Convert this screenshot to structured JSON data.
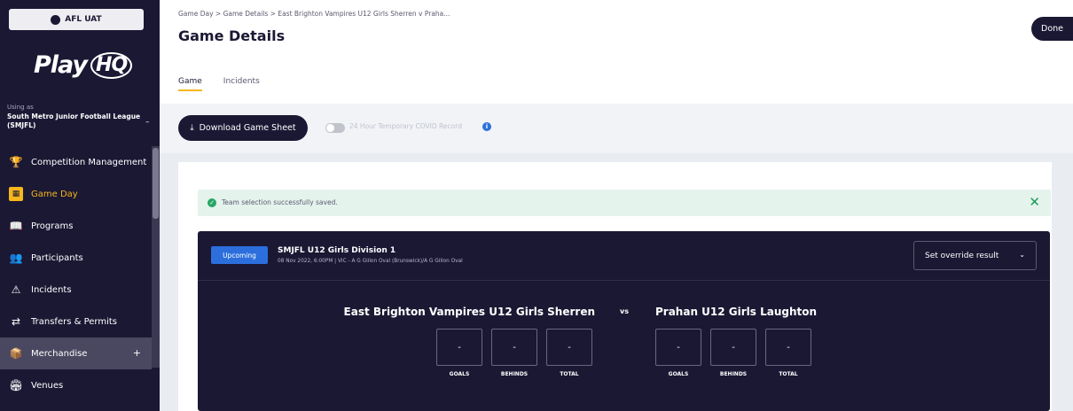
{
  "sidebar": {
    "env_label": "AFL UAT",
    "logo": "PlayHQ",
    "using_as": "Using as",
    "org_name": "South Metro Junior Football League (SMJFL)",
    "items": [
      {
        "label": "Competition Management",
        "icon": "trophy-icon"
      },
      {
        "label": "Game Day",
        "icon": "game-day-icon",
        "active": true
      },
      {
        "label": "Programs",
        "icon": "book-icon"
      },
      {
        "label": "Participants",
        "icon": "people-icon"
      },
      {
        "label": "Incidents",
        "icon": "warning-icon"
      },
      {
        "label": "Transfers & Permits",
        "icon": "transfer-arrows-icon"
      },
      {
        "label": "Merchandise",
        "icon": "box-icon",
        "selected": true,
        "plus": "+"
      },
      {
        "label": "Venues",
        "icon": "venue-icon"
      }
    ]
  },
  "header": {
    "breadcrumb": "Game Day  >  Game Details  >  East Brighton Vampires U12 Girls Sherren v Praha...",
    "title": "Game Details",
    "done_label": "Done",
    "tabs": [
      {
        "label": "Game",
        "active": true
      },
      {
        "label": "Incidents",
        "active": false
      }
    ]
  },
  "toolbar": {
    "download_label": "Download Game Sheet",
    "toggle_label": "24 Hour Temporary COVID Record"
  },
  "alert": {
    "text": "Team selection successfully saved."
  },
  "game": {
    "status": "Upcoming",
    "competition": "SMJFL U12 Girls Division 1",
    "details": "08 Nov 2022, 6:00PM | VIC - A G Gillon Oval (Brunswick)/A G Gillon Oval",
    "override_label": "Set override result",
    "vs_label": "vs",
    "home": {
      "name": "East Brighton Vampires U12 Girls Sherren",
      "goals": "-",
      "behinds": "-",
      "total": "-"
    },
    "away": {
      "name": "Prahan U12 Girls Laughton",
      "goals": "-",
      "behinds": "-",
      "total": "-"
    },
    "labels": {
      "goals": "GOALS",
      "behinds": "BEHINDS",
      "total": "TOTAL"
    }
  },
  "colors": {
    "sidebar_bg": "#1b1834",
    "accent": "#f5b71b",
    "primary_blue": "#2c6fdc",
    "success_green": "#27a566"
  }
}
